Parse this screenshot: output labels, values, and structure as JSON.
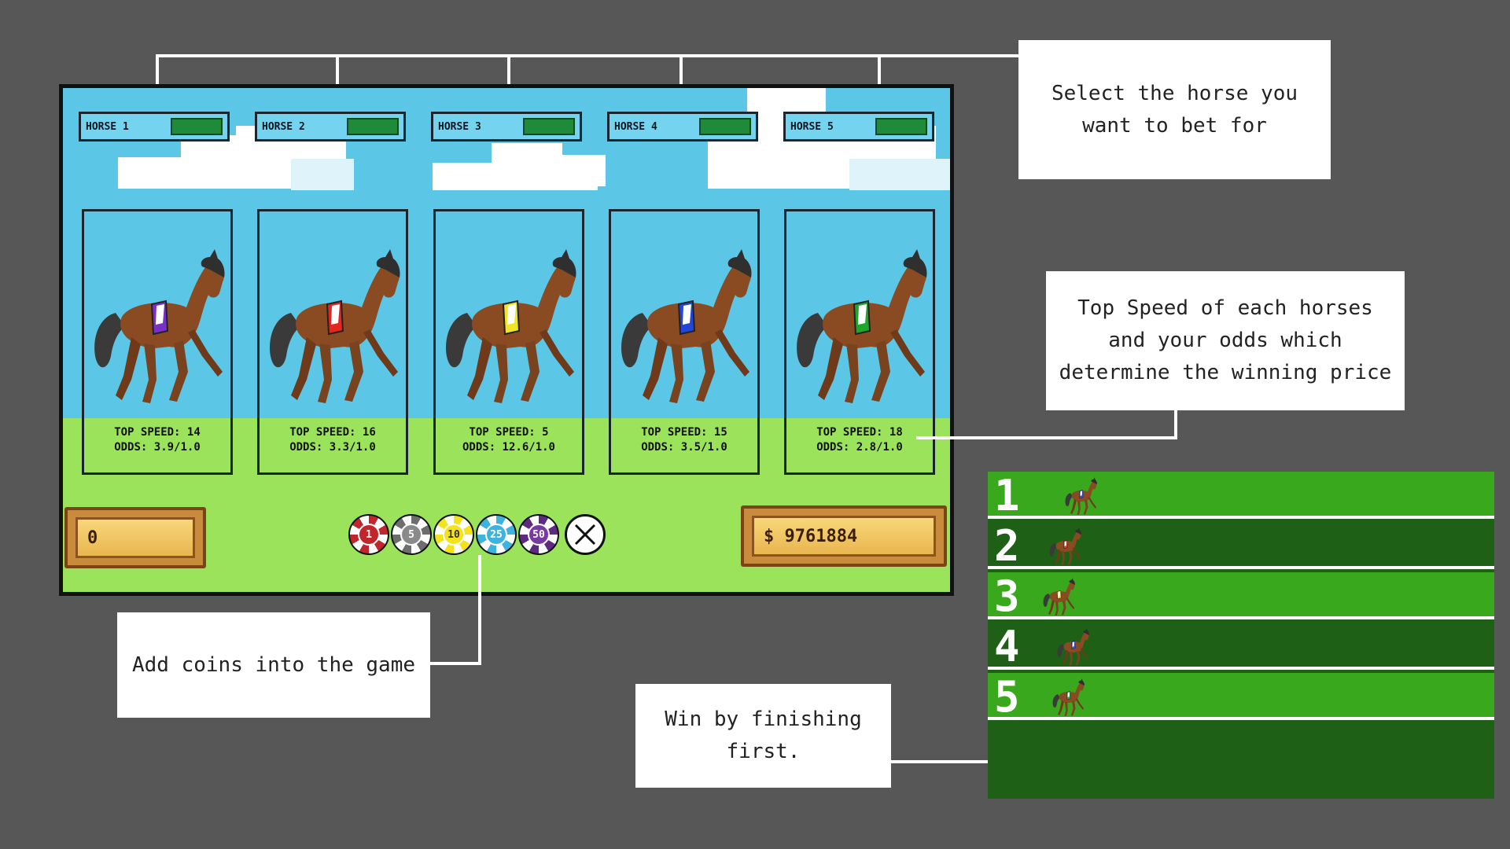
{
  "horses": [
    {
      "label": "HORSE 1",
      "speed": "TOP SPEED: 14",
      "odds": "ODDS: 3.9/1.0",
      "saddle_color": "#7b2fc9"
    },
    {
      "label": "HORSE 2",
      "speed": "TOP SPEED: 16",
      "odds": "ODDS: 3.3/1.0",
      "saddle_color": "#e52520"
    },
    {
      "label": "HORSE 3",
      "speed": "TOP SPEED: 5",
      "odds": "ODDS: 12.6/1.0",
      "saddle_color": "#f1e529"
    },
    {
      "label": "HORSE 4",
      "speed": "TOP SPEED: 15",
      "odds": "ODDS: 3.5/1.0",
      "saddle_color": "#2346d8"
    },
    {
      "label": "HORSE 5",
      "speed": "TOP SPEED: 18",
      "odds": "ODDS: 2.8/1.0",
      "saddle_color": "#1fa72c"
    }
  ],
  "bet_amount": "0",
  "balance": "$ 9761884",
  "chips": [
    {
      "value": "1",
      "color": "#c0262b",
      "face": "#c0262b",
      "text": "#ffffff"
    },
    {
      "value": "5",
      "color": "#6e6e6e",
      "face": "#8a8a8a",
      "text": "#ffffff"
    },
    {
      "value": "10",
      "color": "#f3e21c",
      "face": "#f3e21c",
      "text": "#333333"
    },
    {
      "value": "25",
      "color": "#3fb3df",
      "face": "#3fb3df",
      "text": "#ffffff"
    },
    {
      "value": "50",
      "color": "#5e2a82",
      "face": "#7a3aa4",
      "text": "#ffffff"
    }
  ],
  "annotations": {
    "select_horse": "Select the horse you want to bet for",
    "speed_odds": "Top Speed of each horses and your odds which determine the winning price",
    "add_coins": "Add coins into the game",
    "win": "Win by finishing first."
  },
  "race": {
    "lanes": [
      {
        "number": "1",
        "saddle_color": "#3b4fd6",
        "shade": "light"
      },
      {
        "number": "2",
        "saddle_color": "#e03a2a",
        "shade": "dark"
      },
      {
        "number": "3",
        "saddle_color": "#e8df3a",
        "shade": "light"
      },
      {
        "number": "4",
        "saddle_color": "#3b4fd6",
        "shade": "dark"
      },
      {
        "number": "5",
        "saddle_color": "#2ea83a",
        "shade": "light"
      }
    ],
    "light_color": "#3aa81c",
    "dark_color": "#1e6116"
  }
}
